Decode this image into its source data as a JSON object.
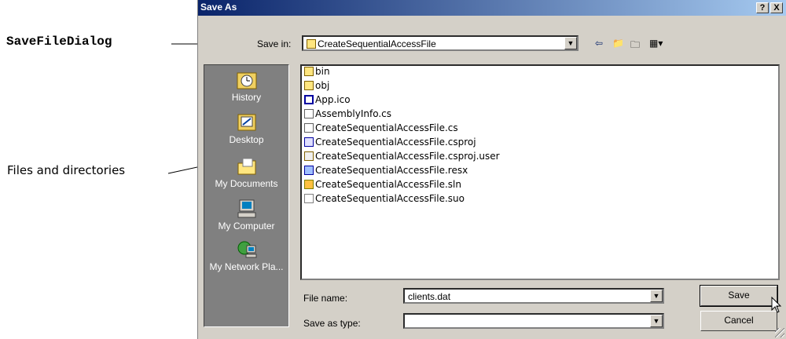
{
  "annotations": {
    "dialog_class": "SaveFileDialog",
    "files_and_directories": "Files and directories"
  },
  "dialog": {
    "title": "Save As",
    "help_button": "?",
    "close_button": "X",
    "save_in_label": "Save in:",
    "save_in_value": "CreateSequentialAccessFile",
    "places": [
      {
        "label": "History",
        "icon": "history-icon"
      },
      {
        "label": "Desktop",
        "icon": "desktop-icon"
      },
      {
        "label": "My Documents",
        "icon": "my-documents-icon"
      },
      {
        "label": "My Computer",
        "icon": "my-computer-icon"
      },
      {
        "label": "My Network Pla...",
        "icon": "network-places-icon"
      }
    ],
    "files": [
      {
        "name": "bin",
        "type": "folder"
      },
      {
        "name": "obj",
        "type": "folder"
      },
      {
        "name": "App.ico",
        "type": "ico"
      },
      {
        "name": "AssemblyInfo.cs",
        "type": "cs"
      },
      {
        "name": "CreateSequentialAccessFile.cs",
        "type": "cs"
      },
      {
        "name": "CreateSequentialAccessFile.csproj",
        "type": "csproj"
      },
      {
        "name": "CreateSequentialAccessFile.csproj.user",
        "type": "user"
      },
      {
        "name": "CreateSequentialAccessFile.resx",
        "type": "resx"
      },
      {
        "name": "CreateSequentialAccessFile.sln",
        "type": "sln"
      },
      {
        "name": "CreateSequentialAccessFile.suo",
        "type": "suo"
      }
    ],
    "file_name_label": "File name:",
    "file_name_value": "clients.dat",
    "save_as_type_label": "Save as type:",
    "save_as_type_value": "",
    "save_button": "Save",
    "cancel_button": "Cancel",
    "colors": {
      "titlebar_start": "#0a246a",
      "titlebar_end": "#a6caf0",
      "face": "#d4d0c8",
      "places_bar": "#808080"
    }
  }
}
